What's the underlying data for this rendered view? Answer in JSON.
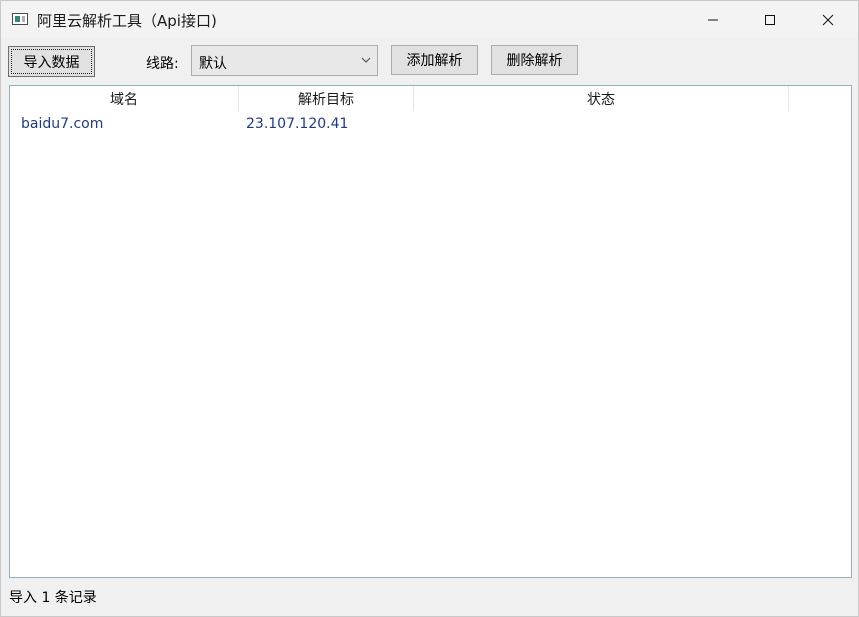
{
  "window": {
    "title": "阿里云解析工具（Api接口)"
  },
  "toolbar": {
    "import_label": "导入数据",
    "route_label": "线路:",
    "route_value": "默认",
    "add_label": "添加解析",
    "delete_label": "删除解析"
  },
  "table": {
    "columns": [
      "域名",
      "解析目标",
      "状态"
    ],
    "rows": [
      {
        "domain": "baidu7.com",
        "target": "23.107.120.41",
        "status": ""
      }
    ]
  },
  "status": {
    "text": "导入 1 条记录"
  },
  "colors": {
    "row_text": "#1f3a8a",
    "list_border": "#8fb0c4"
  }
}
